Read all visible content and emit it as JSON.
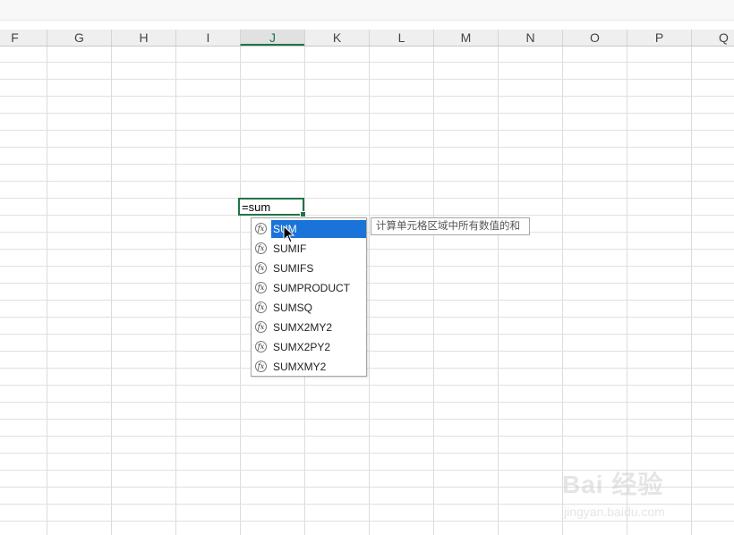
{
  "columns": [
    "F",
    "G",
    "H",
    "I",
    "J",
    "K",
    "L",
    "M",
    "N",
    "O",
    "P",
    "Q"
  ],
  "selected_column": "J",
  "active_cell": {
    "content": "=sum"
  },
  "autocomplete": {
    "icon": "function-icon",
    "items": [
      "SUM",
      "SUMIF",
      "SUMIFS",
      "SUMPRODUCT",
      "SUMSQ",
      "SUMX2MY2",
      "SUMX2PY2",
      "SUMXMY2"
    ],
    "selected_index": 0
  },
  "tooltip": {
    "text": "计算单元格区域中所有数值的和"
  },
  "watermark": {
    "logo": "Bai 经验",
    "url": "jingyan.baidu.com"
  },
  "colors": {
    "accent": "#217346",
    "selection": "#1a73d9"
  }
}
